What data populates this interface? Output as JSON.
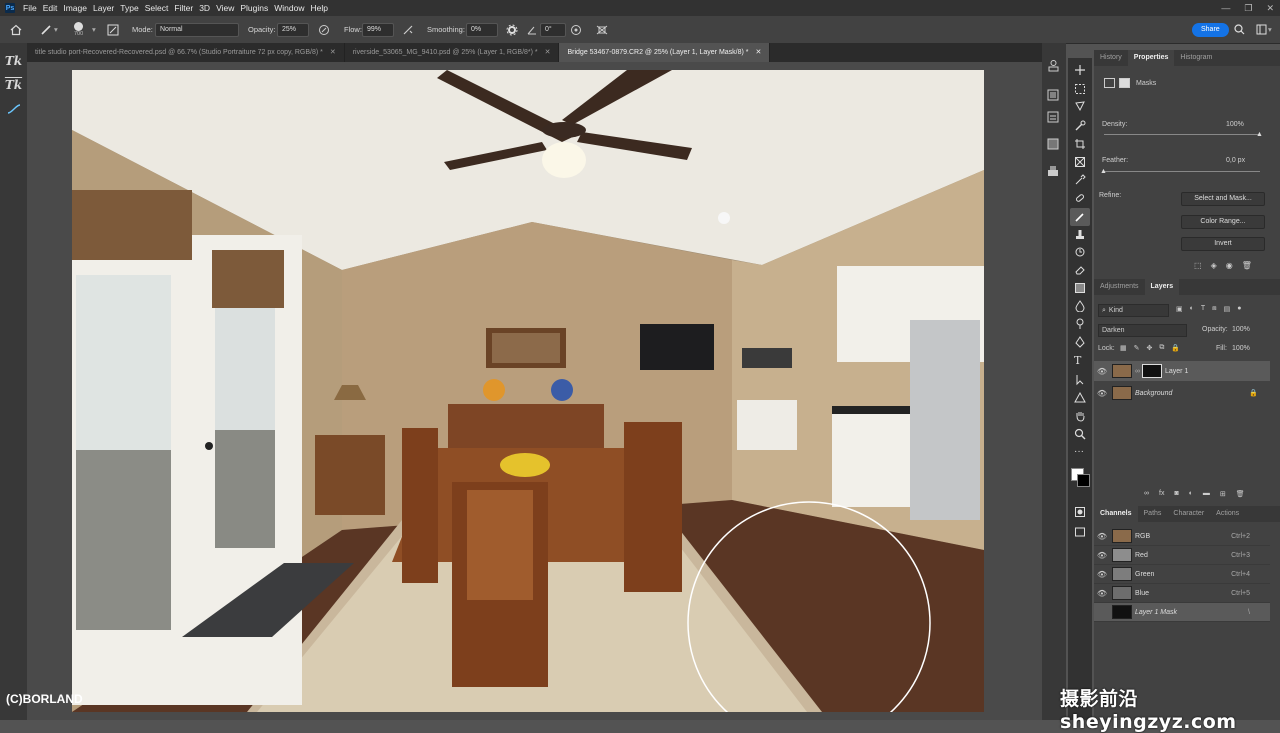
{
  "menu": [
    "File",
    "Edit",
    "Image",
    "Layer",
    "Type",
    "Select",
    "Filter",
    "3D",
    "View",
    "Plugins",
    "Window",
    "Help"
  ],
  "options": {
    "brush_size": "700",
    "mode_label": "Mode:",
    "mode_value": "Normal",
    "opacity_label": "Opacity:",
    "opacity_value": "25%",
    "flow_label": "Flow:",
    "flow_value": "99%",
    "smoothing_label": "Smoothing:",
    "smoothing_value": "0%",
    "angle_value": "0°",
    "share_label": "Share"
  },
  "tabs": [
    {
      "label": "title studio port-Recovered-Recovered.psd @ 66.7% (Studio Portraiture 72 px copy, RGB/8) *"
    },
    {
      "label": "riverside_53065_MG_9410.psd @ 25% (Layer 1, RGB/8*) *"
    },
    {
      "label": "Bridge 53467-0879.CR2 @ 25% (Layer 1, Layer Mask/8) *"
    }
  ],
  "watermark": "(C)BORLAND",
  "footer_watermark": "摄影前沿 sheyingzyz.com",
  "properties": {
    "tabs": [
      "History",
      "Properties",
      "Histogram"
    ],
    "masks_label": "Masks",
    "density_label": "Density:",
    "density_value": "100%",
    "feather_label": "Feather:",
    "feather_value": "0,0 px",
    "refine_label": "Refine:",
    "select_mask_btn": "Select and Mask...",
    "color_range_btn": "Color Range...",
    "invert_btn": "Invert"
  },
  "layers": {
    "tabs": [
      "Adjustments",
      "Layers"
    ],
    "kind_label": "Kind",
    "blend_mode": "Darken",
    "opacity_label": "Opacity:",
    "opacity_value": "100%",
    "lock_label": "Lock:",
    "fill_label": "Fill:",
    "fill_value": "100%",
    "items": [
      {
        "name": "Layer 1"
      },
      {
        "name": "Background"
      }
    ]
  },
  "channels": {
    "tabs": [
      "Channels",
      "Paths",
      "Character",
      "Actions"
    ],
    "items": [
      {
        "name": "RGB",
        "shortcut": "Ctrl+2"
      },
      {
        "name": "Red",
        "shortcut": "Ctrl+3"
      },
      {
        "name": "Green",
        "shortcut": "Ctrl+4"
      },
      {
        "name": "Blue",
        "shortcut": "Ctrl+5"
      },
      {
        "name": "Layer 1 Mask",
        "shortcut": "\\"
      }
    ]
  }
}
